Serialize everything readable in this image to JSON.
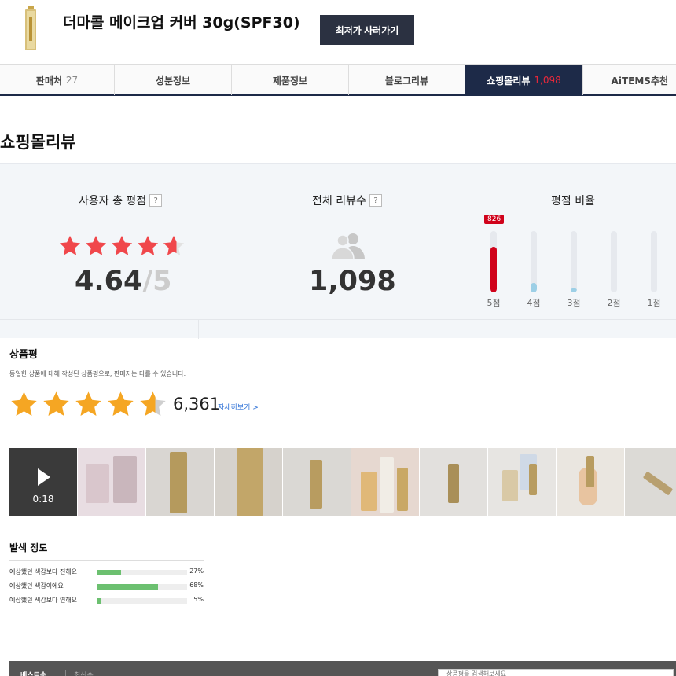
{
  "header": {
    "title": "더마콜 메이크업 커버 30g(SPF30)",
    "buy_button": "최저가 사러가기"
  },
  "tabs": [
    {
      "label": "판매처",
      "count": "27",
      "active": false
    },
    {
      "label": "성분정보",
      "count": "",
      "active": false
    },
    {
      "label": "제품정보",
      "count": "",
      "active": false
    },
    {
      "label": "블로그리뷰",
      "count": "",
      "active": false
    },
    {
      "label": "쇼핑몰리뷰",
      "count": "1,098",
      "active": true
    },
    {
      "label": "AiTEMS추천",
      "count": "",
      "active": false
    }
  ],
  "section_title": "쇼핑몰리뷰",
  "summary": {
    "avg_label": "사용자 총 평점",
    "avg_value": "4.64",
    "avg_max": "5",
    "rating": 4.64,
    "total_label": "전체 리뷰수",
    "total_value": "1,098",
    "help": "?",
    "ratio_label": "평점 비율",
    "distribution": [
      {
        "label": "5점",
        "fraction": 0.75,
        "count": "826",
        "highlight": true
      },
      {
        "label": "4점",
        "fraction": 0.16,
        "count": "",
        "highlight": false
      },
      {
        "label": "3점",
        "fraction": 0.07,
        "count": "",
        "highlight": false
      },
      {
        "label": "2점",
        "fraction": 0.0,
        "count": "",
        "highlight": false
      },
      {
        "label": "1점",
        "fraction": 0.0,
        "count": "",
        "highlight": false
      }
    ]
  },
  "product_rating": {
    "title": "상품평",
    "note": "동일한 상품에 대해 작성된 상품평으로, 판매자는 다를 수 있습니다.",
    "rating": 4.6,
    "count": "6,361",
    "more": "자세히보기 >"
  },
  "photos": {
    "video_time": "0:18"
  },
  "color_section": {
    "title": "발색 정도",
    "rows": [
      {
        "label": "예상했던 색감보다 진해요",
        "pct": "27%",
        "value": 0.27
      },
      {
        "label": "예상했던 색감이에요",
        "pct": "68%",
        "value": 0.68
      },
      {
        "label": "예상했던 색감보다 연해요",
        "pct": "5%",
        "value": 0.05
      }
    ]
  },
  "footer": {
    "tab_primary": "베스트순",
    "tab_divider": "|",
    "tab_secondary": "최신순",
    "search_placeholder": "상품평을 검색해보세요"
  },
  "colors": {
    "navy": "#1d2a48",
    "red_star": "#f0474b",
    "orange_star": "#f5a623",
    "bar_high": "#d0021b",
    "bar_low": "#9ccfe6",
    "color_bar": "#6cc070"
  }
}
